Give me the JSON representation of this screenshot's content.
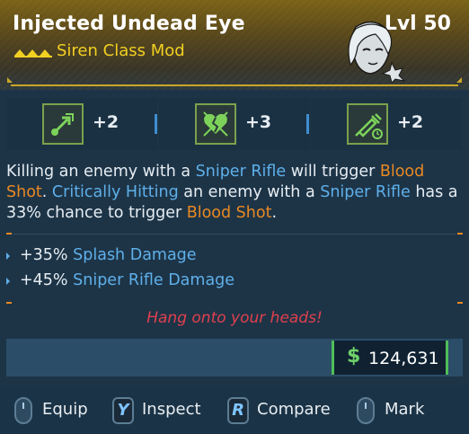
{
  "item": {
    "name": "Injected Undead Eye",
    "level": "Lvl 50",
    "class_mod": "Siren Class Mod",
    "rarity_color": "#f2d022"
  },
  "skills": [
    {
      "icon": "rocket-arrow-icon",
      "value": "+2"
    },
    {
      "icon": "broken-heart-icon",
      "value": "+3"
    },
    {
      "icon": "syringe-timer-icon",
      "value": "+2"
    }
  ],
  "description": {
    "t1": "Killing an enemy with a ",
    "k1": "Sniper Rifle",
    "t2": " will trigger ",
    "k2": "Blood Shot",
    "t3": ". ",
    "k3": "Critically Hitting",
    "t4": " an enemy with a ",
    "k4": "Sniper Rifle",
    "t5": " has a 33% chance to trigger ",
    "k5": "Blood Shot",
    "t6": "."
  },
  "bonuses": [
    {
      "value": "+35%",
      "stat": "Splash Damage"
    },
    {
      "value": "+45%",
      "stat": "Sniper Rifle Damage"
    }
  ],
  "flavor": "Hang onto your heads!",
  "price": {
    "currency": "$",
    "value": "124,631"
  },
  "footer": [
    {
      "key": "mouse",
      "label": "Equip"
    },
    {
      "key": "Y",
      "label": "Inspect"
    },
    {
      "key": "R",
      "label": "Compare"
    },
    {
      "key": "mouse",
      "label": "Mark"
    }
  ],
  "colors": {
    "accent_gold": "#c9a62a",
    "keyword_blue": "#5fb0ea",
    "keyword_orange": "#e98923",
    "price_green": "#4fbf58",
    "flavor_red": "#e0404e"
  }
}
